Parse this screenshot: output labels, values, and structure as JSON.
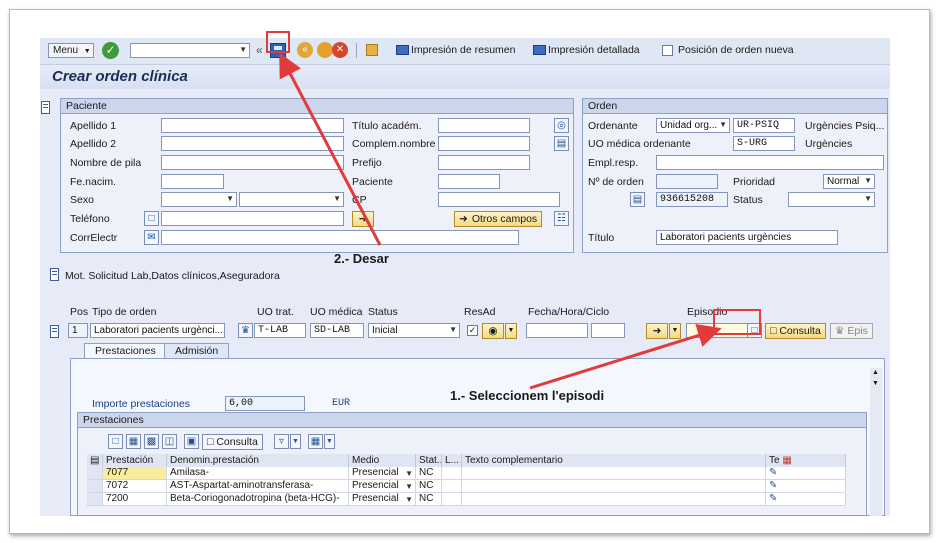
{
  "toolbar": {
    "menu_label": "Menu",
    "print_summary": "Impresión de resumen",
    "print_detail": "Impresión detallada",
    "new_order_position": "Posición de orden nueva"
  },
  "page_title": "Crear orden clínica",
  "patient": {
    "group_title": "Paciente",
    "apellido1": "Apellido 1",
    "apellido2": "Apellido 2",
    "nombre": "Nombre de pila",
    "fenacim": "Fe.nacim.",
    "sexo": "Sexo",
    "telefono": "Teléfono",
    "correo": "CorrElectr",
    "titulo_academ": "Título académ.",
    "complem_nombre": "Complem.nombre",
    "prefijo": "Prefijo",
    "paciente": "Paciente",
    "cp": "CP",
    "otros_campos": "Otros campos"
  },
  "order": {
    "group_title": "Orden",
    "ordenante_label": "Ordenante",
    "ordenante_type": "Unidad org...",
    "ordenante_code": "UR-PSIQ",
    "ordenante_desc": "Urgències Psiq...",
    "uo_medica_label": "UO médica ordenante",
    "uo_medica_code": "S-URG",
    "uo_medica_desc": "Urgències",
    "emplresp_label": "Empl.resp.",
    "num_orden_label": "Nº de orden",
    "num_orden_value": "936615208",
    "prioridad_label": "Prioridad",
    "prioridad_value": "Normal",
    "status_label": "Status",
    "titulo_label": "Título",
    "titulo_value": "Laboratori pacients urgències"
  },
  "mot_solicitud": "Mot. Solicitud Lab,Datos clínicos,Aseguradora",
  "positions": {
    "headers": {
      "pos": "Pos",
      "tipo": "Tipo de orden",
      "uo_trat": "UO trat.",
      "uo_medica": "UO médica",
      "status": "Status",
      "resad": "ResAd",
      "fecha": "Fecha/Hora/Ciclo",
      "episodio": "Episodio"
    },
    "row": {
      "pos": "1",
      "tipo": "Laboratori pacients urgènci...",
      "uo_trat": "T-LAB",
      "uo_medica": "SD-LAB",
      "status": "Inicial"
    },
    "consulta": "Consulta",
    "epis": "Epis"
  },
  "tabs": [
    "Prestaciones",
    "Admisión"
  ],
  "prestaciones": {
    "importe_label": "Importe prestaciones",
    "importe_value": "6,00",
    "currency": "EUR",
    "group_title": "Prestaciones",
    "consulta_btn": "Consulta",
    "columns": {
      "prestacion": "Prestación",
      "denominacion": "Denomin.prestación",
      "medio": "Medio",
      "stat": "Stat...",
      "l": "L...",
      "texto": "Texto complementario",
      "te": "Te"
    },
    "rows": [
      {
        "code": "7077",
        "name": "Amilasa-",
        "medio": "Presencial",
        "stat": "NC"
      },
      {
        "code": "7072",
        "name": "AST-Aspartat-aminotransferasa-",
        "medio": "Presencial",
        "stat": "NC"
      },
      {
        "code": "7200",
        "name": "Beta-Coriogonadotropina (beta-HCG)-",
        "medio": "Presencial",
        "stat": "NC"
      }
    ]
  },
  "annotations": {
    "step1": "1.- Seleccionem l'episodi",
    "step2": "2.- Desar"
  },
  "colors": {
    "annotation_red": "#e23b3b",
    "sap_background": "#e6ebf7"
  }
}
